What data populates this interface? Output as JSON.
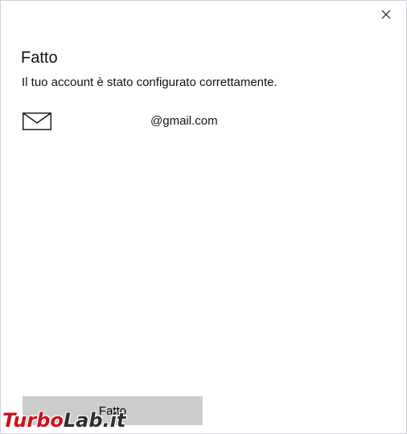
{
  "dialog": {
    "title": "Fatto",
    "message": "Il tuo account è stato configurato correttamente.",
    "account": {
      "icon": "mail-icon",
      "email": "@gmail.com"
    },
    "done_button_label": "Fatto",
    "close_icon": "close-icon"
  },
  "watermark": {
    "part1": "Turbo",
    "part2": "Lab.it"
  },
  "colors": {
    "button_bg": "#cccccc",
    "watermark_red": "#c8141b",
    "watermark_dark": "#2f2f2f"
  }
}
